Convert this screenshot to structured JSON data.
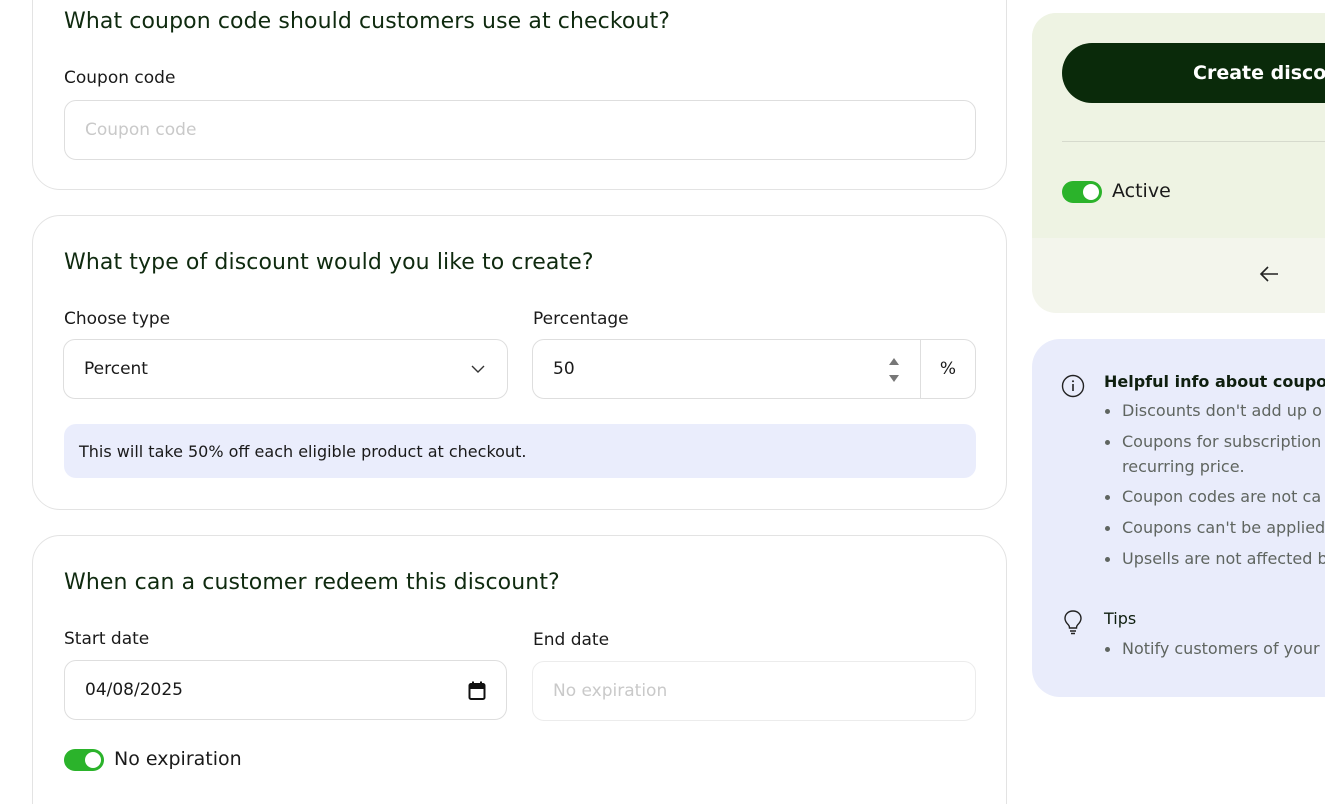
{
  "coupon_section": {
    "question": "What coupon code should customers use at checkout?",
    "label": "Coupon code",
    "placeholder": "Coupon code",
    "value": ""
  },
  "discount_type_section": {
    "question": "What type of discount would you like to create?",
    "type_label": "Choose type",
    "type_value": "Percent",
    "percentage_label": "Percentage",
    "percentage_value": "50",
    "percentage_suffix": "%",
    "info_text": "This will take 50% off each eligible product at checkout."
  },
  "redeem_section": {
    "question": "When can a customer redeem this discount?",
    "start_label": "Start date",
    "start_value": "04/08/2025",
    "end_label": "End date",
    "end_placeholder": "No expiration",
    "no_expiration_label": "No expiration",
    "no_expiration_on": true
  },
  "side_panel": {
    "create_button": "Create discount",
    "active_label": "Active",
    "active_on": true
  },
  "helpful_info": {
    "heading": "Helpful info about coupons",
    "items": [
      "Discounts don't add up o",
      "Coupons for subscription",
      "recurring price.",
      "Coupon codes are not ca",
      "Coupons can't be applied",
      "Upsells are not affected b"
    ],
    "tips_heading": "Tips",
    "tips_items": [
      "Notify customers of your"
    ]
  },
  "colors": {
    "accent_green": "#2bb32b",
    "button_dark": "#0a2a0a",
    "info_bg": "#eaedfc"
  }
}
